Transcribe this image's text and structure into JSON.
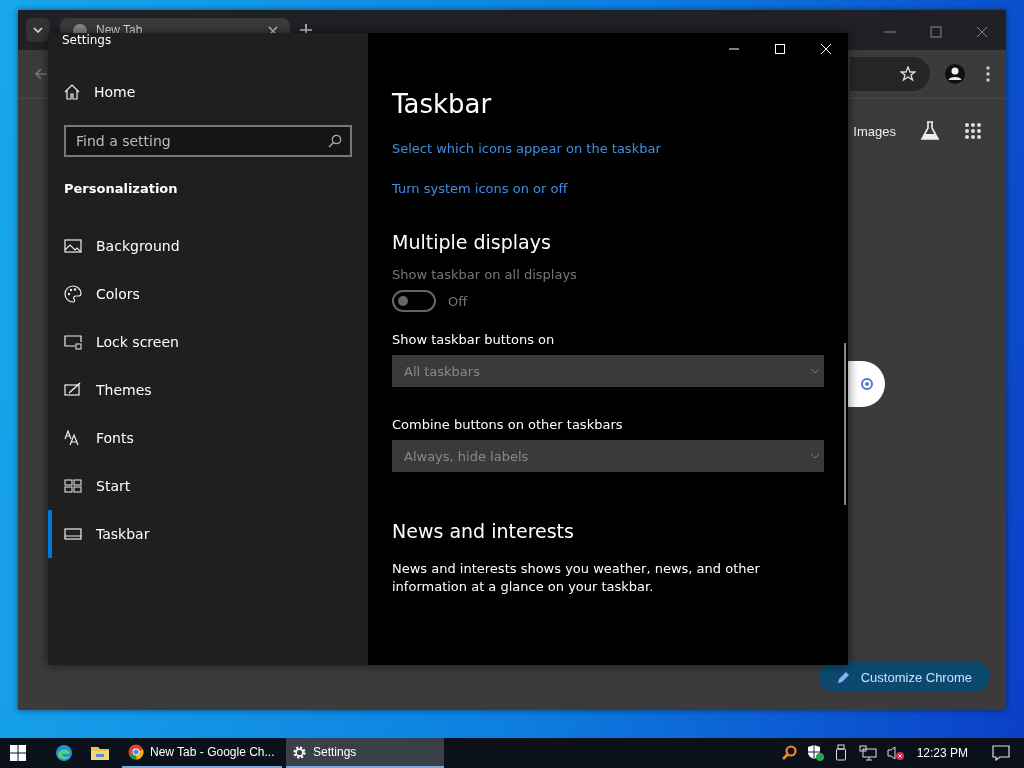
{
  "chrome": {
    "tab_title": "New Tab",
    "header_link": "Images",
    "customize_button": "Customize Chrome"
  },
  "settings": {
    "title": "Settings",
    "home": "Home",
    "search": {
      "placeholder": "Find a setting"
    },
    "section": "Personalization",
    "nav_items": [
      {
        "label": "Background",
        "selected": false
      },
      {
        "label": "Colors",
        "selected": false
      },
      {
        "label": "Lock screen",
        "selected": false
      },
      {
        "label": "Themes",
        "selected": false
      },
      {
        "label": "Fonts",
        "selected": false
      },
      {
        "label": "Start",
        "selected": false
      },
      {
        "label": "Taskbar",
        "selected": true
      }
    ],
    "page_title": "Taskbar",
    "content": [
      {
        "kind": "link",
        "text": "Select which icons appear on the taskbar"
      },
      {
        "kind": "link",
        "text": "Turn system icons on or off"
      },
      {
        "kind": "heading",
        "text": "Multiple displays"
      },
      {
        "kind": "toggle",
        "label": "Show taskbar on all displays",
        "on": false,
        "disabled": true,
        "state_text": "Off"
      },
      {
        "kind": "dropdown",
        "label": "Show taskbar buttons on",
        "value": "All taskbars",
        "disabled": true
      },
      {
        "kind": "dropdown",
        "label": "Combine buttons on other taskbars",
        "value": "Always, hide labels",
        "disabled": true
      },
      {
        "kind": "heading",
        "text": "News and interests"
      },
      {
        "kind": "paragraph",
        "text": "News and interests shows you weather, news, and other information at a glance on your taskbar."
      }
    ]
  },
  "taskbar": {
    "apps": [
      {
        "kind": "icon",
        "selected": false
      },
      {
        "kind": "icon",
        "selected": false
      },
      {
        "kind": "button",
        "label": "New Tab - Google Ch...",
        "selected": false
      },
      {
        "kind": "button",
        "label": "Settings",
        "selected": true
      }
    ],
    "time": "12:23 PM"
  }
}
